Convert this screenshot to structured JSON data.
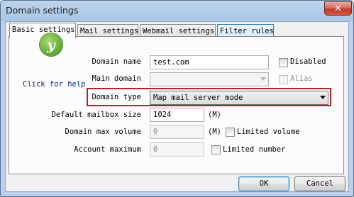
{
  "window": {
    "title": "Domain settings",
    "close_glyph": "✕"
  },
  "tabs": [
    "Basic settings",
    "Mail settings",
    "Webmail settings",
    "Filter rules"
  ],
  "logo": {
    "icon": "mail-server-logo-icon",
    "glyph": "y"
  },
  "help_link": "Click for help",
  "form": {
    "domain_name": {
      "label": "Domain name",
      "value": "test.com"
    },
    "main_domain": {
      "label": "Main domain",
      "value": ""
    },
    "domain_type": {
      "label": "Domain type",
      "value": "Map mail server mode"
    },
    "default_mailbox_size": {
      "label": "Default mailbox size",
      "value": "1024",
      "unit": "(M)"
    },
    "domain_max_volume": {
      "label": "Domain max volume",
      "value": "0",
      "unit": "(M)"
    },
    "account_maximum": {
      "label": "Account maximum",
      "value": "0"
    }
  },
  "checkboxes": {
    "disabled": {
      "label": "Disabled",
      "checked": false
    },
    "alias": {
      "label": "Alias",
      "checked": false
    },
    "limited_volume": {
      "label": "Limited volume",
      "checked": false
    },
    "limited_number": {
      "label": "Limited number",
      "checked": false
    }
  },
  "buttons": {
    "ok": "OK",
    "cancel": "Cancel"
  },
  "colors": {
    "highlight": "#b1242a",
    "link": "#0a2c86",
    "title_bar": "#a9c6e6"
  }
}
